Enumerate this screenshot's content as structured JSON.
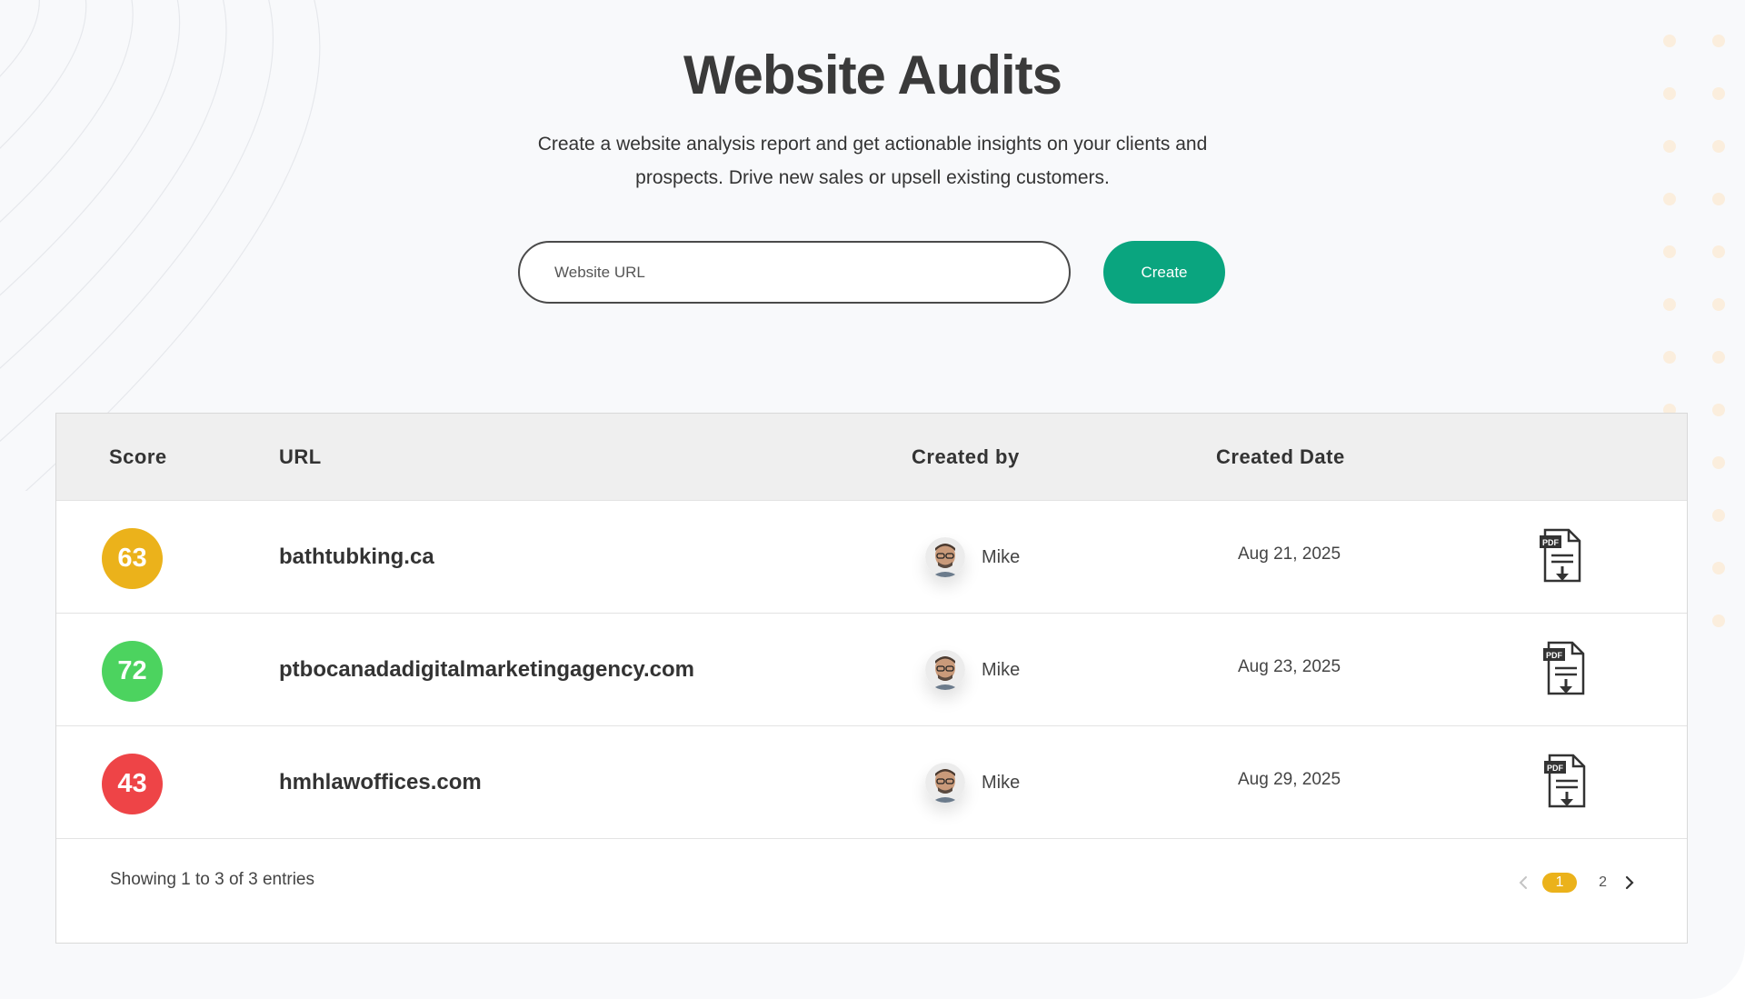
{
  "header": {
    "title": "Website Audits",
    "subtitle": "Create a website analysis report and get actionable insights on your clients and prospects. Drive new sales or upsell existing customers."
  },
  "form": {
    "url_placeholder": "Website URL",
    "create_label": "Create",
    "accent_color": "#0aa57f"
  },
  "table": {
    "columns": [
      "Score",
      "URL",
      "Created by",
      "Created Date"
    ],
    "rows": [
      {
        "score": "63",
        "score_color": "#ebb21b",
        "url": "bathtubking.ca",
        "created_by": "Mike",
        "created_date": "Aug 21, 2025",
        "action_icon": "pdf-download-icon"
      },
      {
        "score": "72",
        "score_color": "#4cd35f",
        "url": "ptbocanadadigitalmarketingagency.com",
        "created_by": "Mike",
        "created_date": "Aug 23, 2025",
        "action_icon": "pdf-download-icon"
      },
      {
        "score": "43",
        "score_color": "#ee4447",
        "url": "hmhlawoffices.com",
        "created_by": "Mike",
        "created_date": "Aug 29, 2025",
        "action_icon": "pdf-download-icon"
      }
    ]
  },
  "footer": {
    "entries_text": "Showing 1 to 3 of 3 entries",
    "pages": [
      "1",
      "2"
    ],
    "current_page": "1",
    "page_accent_color": "#ebb21b"
  }
}
